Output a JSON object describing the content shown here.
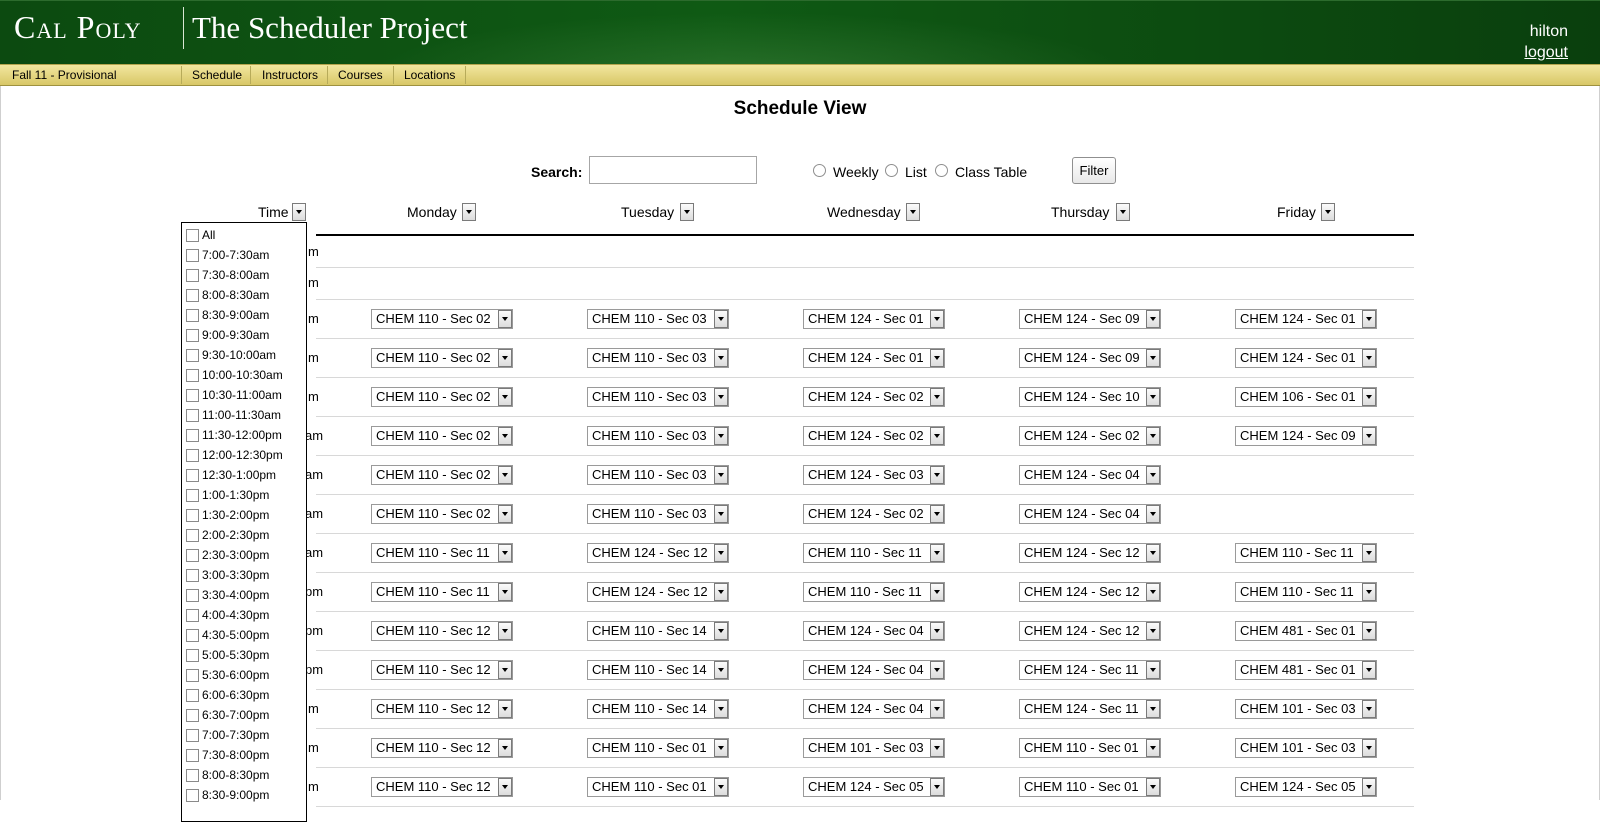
{
  "header": {
    "logo": "Cal Poly",
    "app_title": "The Scheduler Project",
    "username": "hilton",
    "logout_label": "logout"
  },
  "menubar": {
    "term": "Fall 11 - Provisional",
    "items": [
      "Schedule",
      "Instructors",
      "Courses",
      "Locations"
    ]
  },
  "page": {
    "title": "Schedule View",
    "search_label": "Search:",
    "view_options": [
      "Weekly",
      "List",
      "Class Table"
    ],
    "filter_label": "Filter"
  },
  "table": {
    "time_header": "Time",
    "days": [
      "Monday",
      "Tuesday",
      "Wednesday",
      "Thursday",
      "Friday"
    ],
    "row_time_fragments": [
      "m",
      "m",
      "m",
      "m",
      "m",
      "am",
      "am",
      "am",
      "am",
      "pm",
      "pm",
      "pm",
      "m",
      "m",
      "m"
    ],
    "rows": [
      [],
      [],
      [
        "CHEM 110 - Sec 02",
        "CHEM 110 - Sec 03",
        "CHEM 124 - Sec 01",
        "CHEM 124 - Sec 09",
        "CHEM 124 - Sec 01"
      ],
      [
        "CHEM 110 - Sec 02",
        "CHEM 110 - Sec 03",
        "CHEM 124 - Sec 01",
        "CHEM 124 - Sec 09",
        "CHEM 124 - Sec 01"
      ],
      [
        "CHEM 110 - Sec 02",
        "CHEM 110 - Sec 03",
        "CHEM 124 - Sec 02",
        "CHEM 124 - Sec 10",
        "CHEM 106 - Sec 01"
      ],
      [
        "CHEM 110 - Sec 02",
        "CHEM 110 - Sec 03",
        "CHEM 124 - Sec 02",
        "CHEM 124 - Sec 02",
        "CHEM 124 - Sec 09"
      ],
      [
        "CHEM 110 - Sec 02",
        "CHEM 110 - Sec 03",
        "CHEM 124 - Sec 03",
        "CHEM 124 - Sec 04",
        null
      ],
      [
        "CHEM 110 - Sec 02",
        "CHEM 110 - Sec 03",
        "CHEM 124 - Sec 02",
        "CHEM 124 - Sec 04",
        null
      ],
      [
        "CHEM 110 - Sec 11",
        "CHEM 124 - Sec 12",
        "CHEM 110 - Sec 11",
        "CHEM 124 - Sec 12",
        "CHEM 110 - Sec 11"
      ],
      [
        "CHEM 110 - Sec 11",
        "CHEM 124 - Sec 12",
        "CHEM 110 - Sec 11",
        "CHEM 124 - Sec 12",
        "CHEM 110 - Sec 11"
      ],
      [
        "CHEM 110 - Sec 12",
        "CHEM 110 - Sec 14",
        "CHEM 124 - Sec 04",
        "CHEM 124 - Sec 12",
        "CHEM 481 - Sec 01"
      ],
      [
        "CHEM 110 - Sec 12",
        "CHEM 110 - Sec 14",
        "CHEM 124 - Sec 04",
        "CHEM 124 - Sec 11",
        "CHEM 481 - Sec 01"
      ],
      [
        "CHEM 110 - Sec 12",
        "CHEM 110 - Sec 14",
        "CHEM 124 - Sec 04",
        "CHEM 124 - Sec 11",
        "CHEM 101 - Sec 03"
      ],
      [
        "CHEM 110 - Sec 12",
        "CHEM 110 - Sec 01",
        "CHEM 101 - Sec 03",
        "CHEM 110 - Sec 01",
        "CHEM 101 - Sec 03"
      ],
      [
        "CHEM 110 - Sec 12",
        "CHEM 110 - Sec 01",
        "CHEM 124 - Sec 05",
        "CHEM 110 - Sec 01",
        "CHEM 124 - Sec 05"
      ]
    ]
  },
  "time_filter": {
    "options": [
      "All",
      "7:00-7:30am",
      "7:30-8:00am",
      "8:00-8:30am",
      "8:30-9:00am",
      "9:00-9:30am",
      "9:30-10:00am",
      "10:00-10:30am",
      "10:30-11:00am",
      "11:00-11:30am",
      "11:30-12:00pm",
      "12:00-12:30pm",
      "12:30-1:00pm",
      "1:00-1:30pm",
      "1:30-2:00pm",
      "2:00-2:30pm",
      "2:30-3:00pm",
      "3:00-3:30pm",
      "3:30-4:00pm",
      "4:00-4:30pm",
      "4:30-5:00pm",
      "5:00-5:30pm",
      "5:30-6:00pm",
      "6:00-6:30pm",
      "6:30-7:00pm",
      "7:00-7:30pm",
      "7:30-8:00pm",
      "8:00-8:30pm",
      "8:30-9:00pm"
    ]
  }
}
